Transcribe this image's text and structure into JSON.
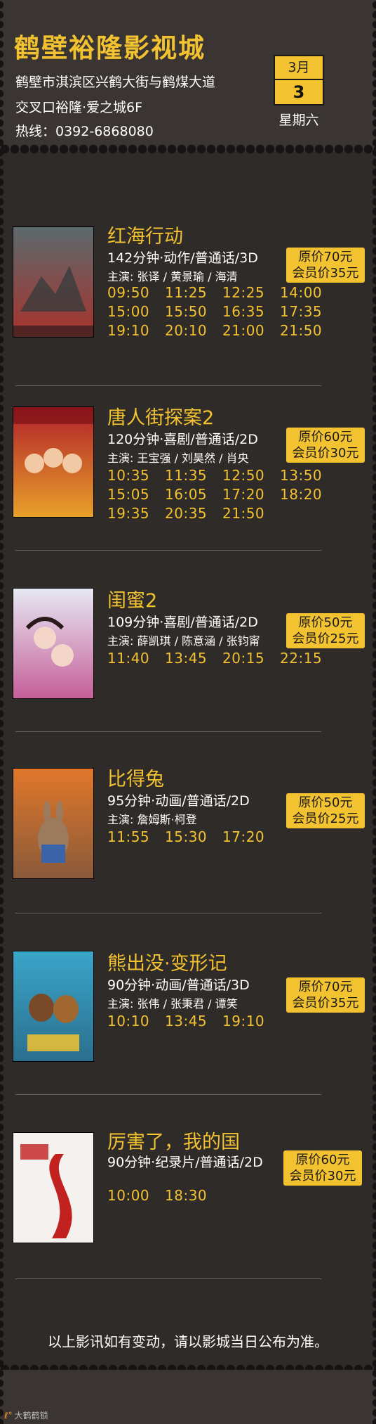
{
  "header": {
    "cinema_name": "鹤壁裕隆影视城",
    "address_line1": "鹤壁市淇滨区兴鹤大街与鹤煤大道",
    "address_line2": "交叉口裕隆·爱之城6F",
    "hotline": "热线：0392-6868080",
    "date": {
      "month": "3月",
      "day": "3",
      "weekday": "星期六"
    }
  },
  "movies": [
    {
      "title": "红海行动",
      "meta": "142分钟·动作/普通话/3D",
      "cast": "主演: 张译 / 黄景瑜 / 海清",
      "price_original": "原价70元",
      "price_member": "会员价35元",
      "times": [
        [
          "09:50",
          "11:25",
          "12:25",
          "14:00"
        ],
        [
          "15:00",
          "15:50",
          "16:35",
          "17:35"
        ],
        [
          "19:10",
          "20:10",
          "21:00",
          "21:50"
        ]
      ],
      "poster_colors": [
        "#5b6a6d",
        "#a8322c"
      ]
    },
    {
      "title": "唐人街探案2",
      "meta": "120分钟·喜剧/普通话/2D",
      "cast": "主演: 王宝强 / 刘昊然 / 肖央",
      "price_original": "原价60元",
      "price_member": "会员价30元",
      "times": [
        [
          "10:35",
          "11:35",
          "12:50",
          "13:50"
        ],
        [
          "15:05",
          "16:05",
          "17:20",
          "18:20"
        ],
        [
          "19:35",
          "20:35",
          "21:50"
        ]
      ],
      "poster_colors": [
        "#b0202a",
        "#e8a02a"
      ]
    },
    {
      "title": "闺蜜2",
      "meta": "109分钟·喜剧/普通话/2D",
      "cast": "主演: 薛凯琪 / 陈意涵 / 张钧甯",
      "price_original": "原价50元",
      "price_member": "会员价25元",
      "times": [
        [
          "11:40",
          "13:45",
          "20:15",
          "22:15"
        ]
      ],
      "poster_colors": [
        "#e6e8f2",
        "#c65f9a"
      ]
    },
    {
      "title": "比得兔",
      "meta": "95分钟·动画/普通话/2D",
      "cast": "主演: 詹姆斯·柯登",
      "price_original": "原价50元",
      "price_member": "会员价25元",
      "times": [
        [
          "11:55",
          "15:30",
          "17:20"
        ]
      ],
      "poster_colors": [
        "#e0772a",
        "#8a5a3a"
      ]
    },
    {
      "title": "熊出没·变形记",
      "meta": "90分钟·动画/普通话/3D",
      "cast": "主演: 张伟 / 张秉君 / 谭笑",
      "price_original": "原价70元",
      "price_member": "会员价35元",
      "times": [
        [
          "10:10",
          "13:45",
          "19:10"
        ]
      ],
      "poster_colors": [
        "#3aa5c8",
        "#2b6f8f"
      ]
    },
    {
      "title": "厉害了，我的国",
      "meta": "90分钟·纪录片/普通话/2D",
      "cast": "",
      "price_original": "原价60元",
      "price_member": "会员价30元",
      "times": [
        [
          "10:00",
          "18:30"
        ]
      ],
      "poster_colors": [
        "#f4f1ee",
        "#c2221f"
      ]
    }
  ],
  "footer": {
    "note": "以上影讯如有变动，请以影城当日公布为准。",
    "watermark": "大鹤鹤锁"
  }
}
